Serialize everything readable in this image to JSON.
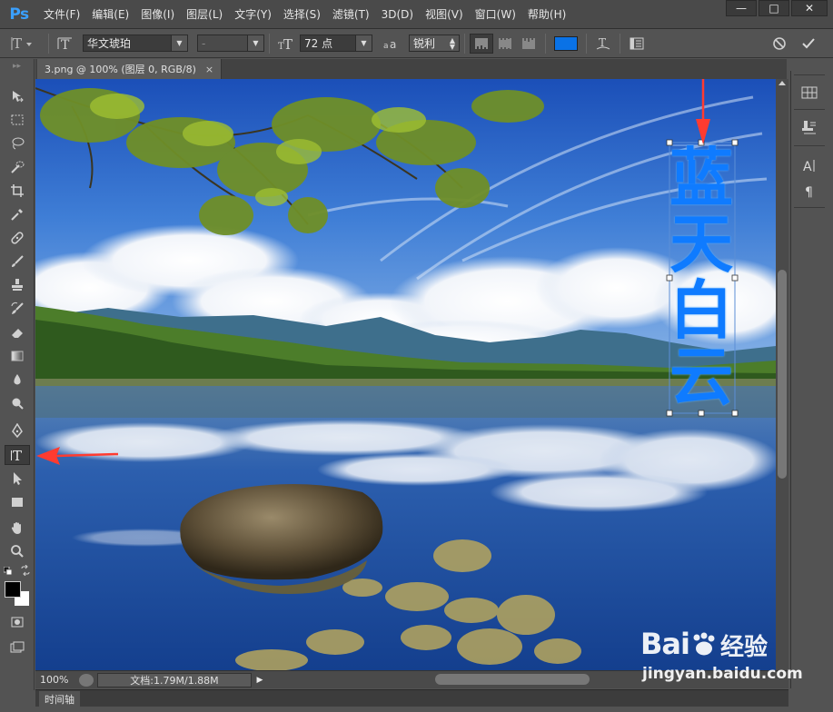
{
  "app": {
    "logo": "Ps",
    "menu": [
      "文件(F)",
      "编辑(E)",
      "图像(I)",
      "图层(L)",
      "文字(Y)",
      "选择(S)",
      "滤镜(T)",
      "3D(D)",
      "视图(V)",
      "窗口(W)",
      "帮助(H)"
    ],
    "window_controls": {
      "minimize": "—",
      "maximize": "□",
      "close": "✕"
    }
  },
  "options": {
    "tool_icon": "↓T",
    "orient_icon": "⇵T",
    "font_family": "华文琥珀",
    "font_style": "-",
    "size_icon": "tT",
    "font_size": "72 点",
    "aa_icon": "ªa",
    "anti_alias": "锐利",
    "text_color": "#0a72e6",
    "warp_icon": "T-warp",
    "cancel_icon": "cancel",
    "commit_icon": "commit"
  },
  "document": {
    "tab_title": "3.png @ 100% (图层 0, RGB/8)",
    "tab_close": "×",
    "text_layer_chars": [
      "蓝",
      "天",
      "白",
      "云"
    ],
    "text_color": "#0f7bff"
  },
  "status": {
    "zoom": "100%",
    "doc_info": "文档:1.79M/1.88M",
    "play": "▶"
  },
  "timeline": {
    "label": "时间轴"
  },
  "watermark": {
    "brand": "Bai",
    "brand_suffix": "经验",
    "url": "jingyan.baidu.com"
  }
}
